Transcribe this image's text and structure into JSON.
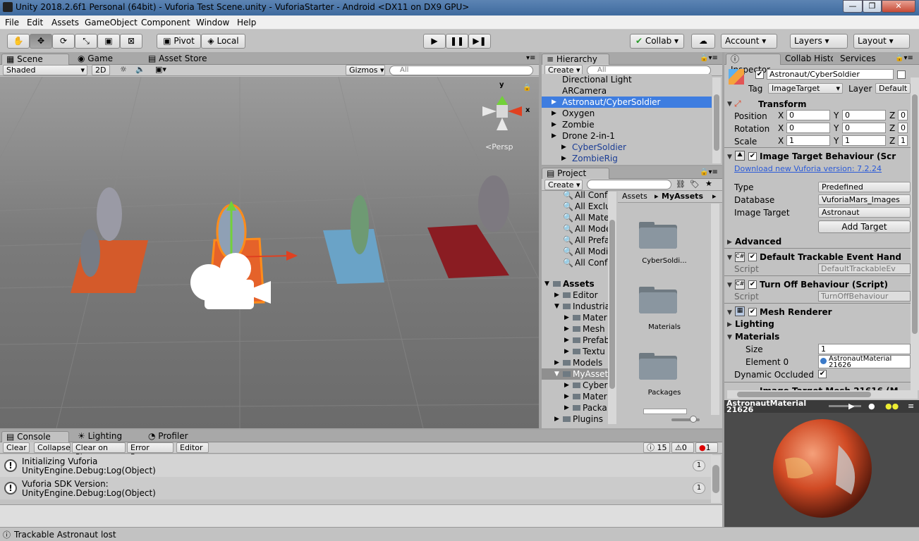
{
  "window": {
    "title": "Unity 2018.2.6f1 Personal (64bit) - Vuforia Test Scene.unity - VuforiaStarter - Android <DX11 on DX9 GPU>",
    "minimize": "—",
    "maximize": "❐",
    "close": "✕"
  },
  "menu": [
    "File",
    "Edit",
    "Assets",
    "GameObject",
    "Component",
    "Window",
    "Help"
  ],
  "toolbar": {
    "pivot": "Pivot",
    "local": "Local",
    "collab": "Collab ▾",
    "account": "Account",
    "layers": "Layers",
    "layout": "Layout"
  },
  "scene": {
    "tabs": [
      "Scene",
      "Game",
      "Asset Store"
    ],
    "shading": "Shaded",
    "mode_2d": "2D",
    "gizmos": "Gizmos",
    "search_placeholder": "All",
    "persp_label": "<Persp",
    "axis_y": "y",
    "axis_x": "x"
  },
  "hierarchy": {
    "title": "Hierarchy",
    "create": "Create",
    "search_placeholder": "All",
    "items": [
      {
        "label": "Directional Light",
        "indent": 0,
        "arrow": false,
        "selected": false,
        "blue": false
      },
      {
        "label": "ARCamera",
        "indent": 0,
        "arrow": false,
        "selected": false,
        "blue": false
      },
      {
        "label": "Astronaut/CyberSoldier",
        "indent": 0,
        "arrow": true,
        "selected": true,
        "blue": false
      },
      {
        "label": "Oxygen",
        "indent": 0,
        "arrow": true,
        "selected": false,
        "blue": false
      },
      {
        "label": "Zombie",
        "indent": 0,
        "arrow": true,
        "selected": false,
        "blue": false
      },
      {
        "label": "Drone 2-in-1",
        "indent": 0,
        "arrow": true,
        "selected": false,
        "blue": false
      },
      {
        "label": "CyberSoldier",
        "indent": 1,
        "arrow": true,
        "selected": false,
        "blue": true
      },
      {
        "label": "ZombieRig",
        "indent": 1,
        "arrow": true,
        "selected": false,
        "blue": true
      }
    ]
  },
  "project": {
    "title": "Project",
    "create": "Create",
    "favorites": [
      "All Confl",
      "All Exclu",
      "All Mater",
      "All Mode",
      "All Prefa",
      "All Modif",
      "All Confl"
    ],
    "tree": [
      {
        "label": "Assets",
        "level": 0,
        "bold": true,
        "open": true
      },
      {
        "label": "Editor",
        "level": 1,
        "bold": false,
        "open": false
      },
      {
        "label": "Industria",
        "level": 1,
        "bold": false,
        "open": true
      },
      {
        "label": "Mater",
        "level": 2,
        "bold": false,
        "open": false
      },
      {
        "label": "Mesh",
        "level": 2,
        "bold": false,
        "open": false
      },
      {
        "label": "Prefab",
        "level": 2,
        "bold": false,
        "open": false
      },
      {
        "label": "Textu",
        "level": 2,
        "bold": false,
        "open": false
      },
      {
        "label": "Models",
        "level": 1,
        "bold": false,
        "open": false
      },
      {
        "label": "MyAsset",
        "level": 1,
        "bold": false,
        "open": true,
        "selected": true
      },
      {
        "label": "Cyber",
        "level": 2,
        "bold": false,
        "open": false
      },
      {
        "label": "Mater",
        "level": 2,
        "bold": false,
        "open": false
      },
      {
        "label": "Packa",
        "level": 2,
        "bold": false,
        "open": false
      },
      {
        "label": "Plugins",
        "level": 1,
        "bold": false,
        "open": false
      }
    ],
    "breadcrumb_root": "Assets",
    "breadcrumb_current": "MyAssets",
    "folders": [
      "CyberSoldi...",
      "Materials",
      "Packages"
    ]
  },
  "inspector": {
    "tabs": [
      "Inspector",
      "Collab Histo",
      "Services"
    ],
    "object_name": "Astronaut/CyberSoldier",
    "tag_label": "Tag",
    "tag_value": "ImageTarget",
    "layer_label": "Layer",
    "layer_value": "Default",
    "transform": {
      "title": "Transform",
      "position_label": "Position",
      "rotation_label": "Rotation",
      "scale_label": "Scale",
      "position": [
        "0",
        "0",
        "0"
      ],
      "rotation": [
        "0",
        "0",
        "0"
      ],
      "scale": [
        "1",
        "1",
        "1"
      ],
      "x": "X",
      "y": "Y",
      "z": "Z"
    },
    "image_target": {
      "title": "Image Target Behaviour (Scr",
      "download_link": "Download new Vuforia version: 7.2.24",
      "type_label": "Type",
      "type_value": "Predefined",
      "database_label": "Database",
      "database_value": "VuforiaMars_Images",
      "target_label": "Image Target",
      "target_value": "Astronaut",
      "add_target": "Add Target",
      "advanced": "Advanced"
    },
    "trackable": {
      "title": "Default Trackable Event Hand",
      "script_label": "Script",
      "script_value": "DefaultTrackableEv"
    },
    "turn_off": {
      "title": "Turn Off Behaviour (Script)",
      "script_label": "Script",
      "script_value": "TurnOffBehaviour"
    },
    "mesh_renderer": {
      "title": "Mesh Renderer",
      "lighting": "Lighting",
      "materials": "Materials",
      "size_label": "Size",
      "size_value": "1",
      "element_label": "Element 0",
      "element_value": "AstronautMaterial 21626",
      "dynamic_label": "Dynamic Occluded"
    },
    "next_component": "Image Target Mesh 21616 (M",
    "preview_title": "AstronautMaterial 21626"
  },
  "console": {
    "tabs": [
      "Console",
      "Lighting",
      "Profiler"
    ],
    "clear": "Clear",
    "collapse": "Collapse",
    "clear_on_play": "Clear on Play",
    "error_pause": "Error Pause",
    "editor": "Editor",
    "count_log": "15",
    "count_warn": "0",
    "count_error": "1",
    "entries": [
      {
        "line1": "Initializing Vuforia",
        "line2": "UnityEngine.Debug:Log(Object)",
        "count": "1"
      },
      {
        "line1": "Vuforia SDK Version:",
        "line2": "UnityEngine.Debug:Log(Object)",
        "count": "1"
      }
    ]
  },
  "status": {
    "message": "Trackable Astronaut lost"
  }
}
